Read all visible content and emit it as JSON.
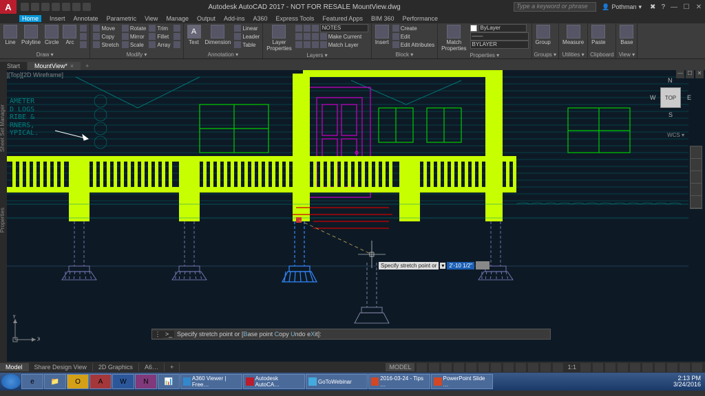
{
  "titlebar": {
    "app_title": "Autodesk AutoCAD 2017 - NOT FOR RESALE   MountView.dwg",
    "search_placeholder": "Type a keyword or phrase",
    "user": "Pothman"
  },
  "menubar": {
    "items": [
      "Home",
      "Insert",
      "Annotate",
      "Parametric",
      "View",
      "Manage",
      "Output",
      "Add-ins",
      "A360",
      "Express Tools",
      "Featured Apps",
      "BIM 360",
      "Performance"
    ],
    "active": "Home"
  },
  "ribbon": {
    "panels": [
      {
        "title": "Draw ▾",
        "big": [
          {
            "lbl": "Line"
          },
          {
            "lbl": "Polyline"
          },
          {
            "lbl": "Circle"
          },
          {
            "lbl": "Arc"
          }
        ]
      },
      {
        "title": "Modify ▾",
        "rows": [
          [
            "Move",
            "Rotate",
            "Trim"
          ],
          [
            "Copy",
            "Mirror",
            "Fillet"
          ],
          [
            "Stretch",
            "Scale",
            "Array"
          ]
        ]
      },
      {
        "title": "Annotation ▾",
        "big": [
          {
            "lbl": "Text"
          },
          {
            "lbl": "Dimension"
          }
        ],
        "rows": [
          [
            "Linear"
          ],
          [
            "Leader"
          ],
          [
            "Table"
          ]
        ]
      },
      {
        "title": "Layers ▾",
        "big": [
          {
            "lbl": "Layer\nProperties"
          }
        ],
        "rows": [
          [
            "Make Current"
          ],
          [
            "Match Layer"
          ]
        ],
        "dd": "NOTES"
      },
      {
        "title": "Block ▾",
        "big": [
          {
            "lbl": "Insert"
          }
        ],
        "rows": [
          [
            "Create"
          ],
          [
            "Edit"
          ],
          [
            "Edit Attributes"
          ]
        ]
      },
      {
        "title": "Properties ▾",
        "big": [
          {
            "lbl": "Match\nProperties"
          }
        ],
        "dds": [
          "ByLayer",
          "——",
          "BYLAYER"
        ]
      },
      {
        "title": "Groups ▾",
        "big": [
          {
            "lbl": "Group"
          }
        ]
      },
      {
        "title": "Utilities ▾",
        "big": [
          {
            "lbl": "Measure"
          }
        ]
      },
      {
        "title": "Clipboard",
        "big": [
          {
            "lbl": "Paste"
          }
        ]
      },
      {
        "title": "View ▾",
        "big": [
          {
            "lbl": "Base"
          }
        ]
      }
    ]
  },
  "filetabs": {
    "start": "Start",
    "active": "MountView*"
  },
  "viewlabel": "[-][Top][2D Wireframe]",
  "note_text": "AMETER\nD LOGS\nRIBE &\nRNERS,\nYPICAL.",
  "viewcube": {
    "face": "TOP",
    "n": "N",
    "s": "S",
    "e": "E",
    "w": "W",
    "wcs": "WCS ▾"
  },
  "drag": {
    "label": "Specify stretch point or",
    "value": "2'-10 1/2\""
  },
  "command": {
    "prefix": ">_",
    "text": "Specify stretch point or [",
    "kw1": "B",
    "kw1rest": "ase point ",
    "kw2": "C",
    "kw2rest": "opy ",
    "kw3": "U",
    "kw3rest": "ndo ",
    "kw4": "e",
    "kw4rest": "X",
    "kw5": "it",
    "suffix": "]:"
  },
  "layouttabs": [
    "Model",
    "Share Design View",
    "2D Graphics",
    "A6…"
  ],
  "statusbar": {
    "model": "MODEL",
    "scale": "1:1"
  },
  "taskbar": {
    "apps": [
      "e",
      "📁",
      "O",
      "A",
      "W",
      "N",
      "📊"
    ],
    "tasks": [
      "Autodesk AutoCA…",
      "GoToWebinar",
      "2016-03-24 - Tips …",
      "PowerPoint Slide …"
    ],
    "time": "2:13 PM",
    "date": "3/24/2016"
  },
  "leftpanels": [
    "Properties",
    "Sheet Set Manager"
  ],
  "ucs": {
    "x": "X",
    "y": "Y"
  }
}
